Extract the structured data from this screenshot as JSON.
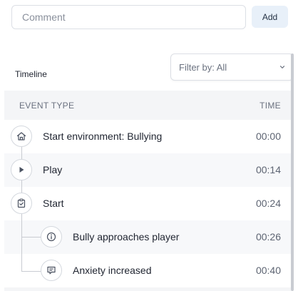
{
  "comment": {
    "placeholder": "Comment",
    "value": ""
  },
  "add_button": {
    "label": "Add"
  },
  "timeline": {
    "title": "Timeline",
    "filter": {
      "label": "Filter by: All"
    },
    "columns": {
      "event_type": "EVENT TYPE",
      "time": "TIME"
    },
    "events": [
      {
        "icon": "home-icon",
        "label": "Start environment: Bullying",
        "time": "00:00"
      },
      {
        "icon": "play-icon",
        "label": "Play",
        "time": "00:14"
      },
      {
        "icon": "clipboard-check-icon",
        "label": "Start",
        "time": "00:24"
      },
      {
        "icon": "info-icon",
        "label": "Bully approaches player",
        "time": "00:26"
      },
      {
        "icon": "message-icon",
        "label": "Anxiety increased",
        "time": "00:40"
      }
    ]
  },
  "colors": {
    "accent_button_bg": "#e8f0f9",
    "header_bg": "#f4f5f7",
    "row_shade": "#f7f8fa",
    "tree_line": "#c9ccd2"
  }
}
